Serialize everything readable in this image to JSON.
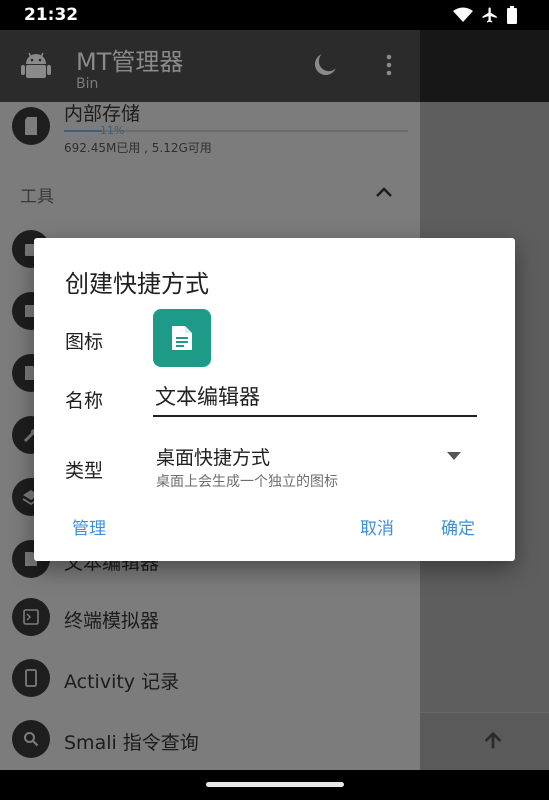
{
  "status": {
    "time": "21:32"
  },
  "appbar": {
    "title": "MT管理器",
    "subtitle": "Bin"
  },
  "drawer": {
    "storage": {
      "label": "内部存储",
      "percent": "11%",
      "fraction": 0.11,
      "detail": "692.45M已用 , 5.12G可用"
    },
    "section_title": "工具",
    "items": [
      {
        "label": "文本编辑器",
        "icon": "document-icon"
      },
      {
        "label": "终端模拟器",
        "icon": "terminal-icon"
      },
      {
        "label": "Activity 记录",
        "icon": "phone-icon"
      },
      {
        "label": "Smali 指令查询",
        "icon": "search-icon"
      }
    ]
  },
  "dialog": {
    "title": "创建快捷方式",
    "icon_label": "图标",
    "name_label": "名称",
    "name_value": "文本编辑器",
    "type_label": "类型",
    "type_value": "桌面快捷方式",
    "type_desc": "桌面上会生成一个独立的图标",
    "manage_button": "管理",
    "cancel_button": "取消",
    "ok_button": "确定"
  },
  "colors": {
    "accent": "#3d8fd6",
    "icon_tile": "#1d9a88"
  }
}
